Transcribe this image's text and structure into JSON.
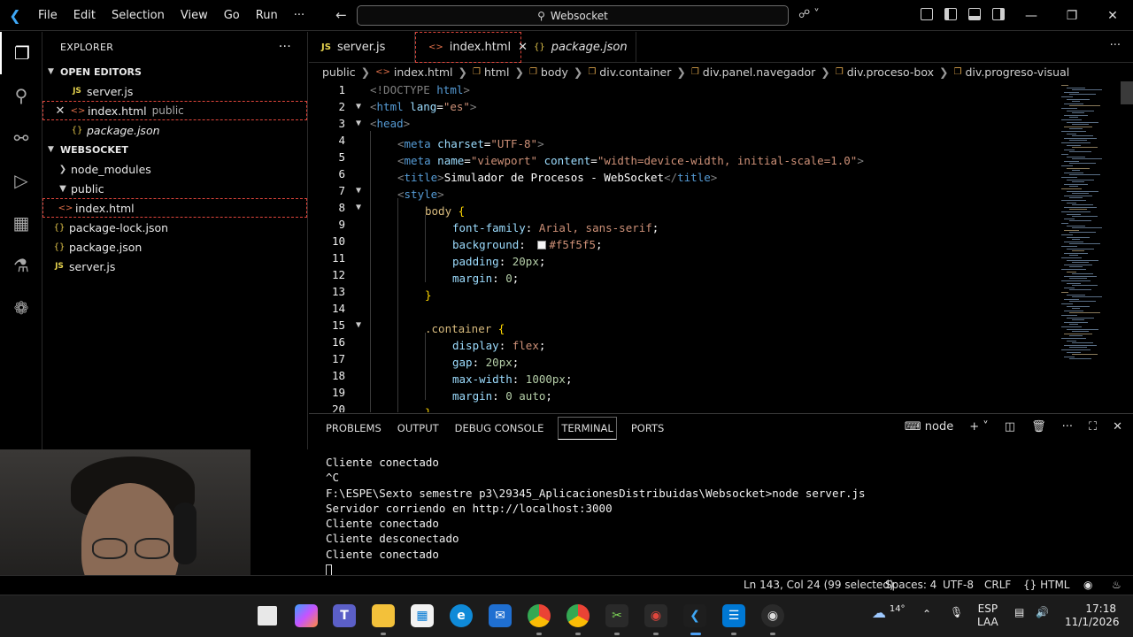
{
  "titlebar": {
    "menu": [
      "File",
      "Edit",
      "Selection",
      "View",
      "Go",
      "Run",
      "···"
    ],
    "search": "Websocket"
  },
  "sidebar": {
    "title": "EXPLORER",
    "open_editors_label": "OPEN EDITORS",
    "open_editors": [
      {
        "name": "server.js",
        "type": "js",
        "hint": ""
      },
      {
        "name": "index.html",
        "type": "html",
        "hint": "public"
      },
      {
        "name": "package.json",
        "type": "json",
        "hint": ""
      }
    ],
    "workspace_label": "WEBSOCKET",
    "tree": [
      {
        "name": "node_modules",
        "kind": "folder-closed"
      },
      {
        "name": "public",
        "kind": "folder-open"
      },
      {
        "name": "index.html",
        "kind": "html"
      },
      {
        "name": "package-lock.json",
        "kind": "json"
      },
      {
        "name": "package.json",
        "kind": "json"
      },
      {
        "name": "server.js",
        "kind": "js"
      }
    ]
  },
  "tabs": [
    {
      "label": "server.js",
      "icon": "JS"
    },
    {
      "label": "index.html",
      "icon": "<>"
    },
    {
      "label": "package.json",
      "icon": "{}"
    }
  ],
  "breadcrumb": [
    "public",
    "index.html",
    "html",
    "body",
    "div.container",
    "div.panel.navegador",
    "div.proceso-box",
    "div.progreso-visual"
  ],
  "code": {
    "line_numbers": [
      "1",
      "2",
      "3",
      "4",
      "5",
      "6",
      "7",
      "8",
      "9",
      "10",
      "11",
      "12",
      "13",
      "14",
      "15",
      "16",
      "17",
      "18",
      "19",
      "20"
    ],
    "l1": {
      "a": "<!DOCTYPE ",
      "b": "html",
      "c": ">"
    },
    "l2": {
      "a": "<",
      "b": "html",
      "c": "lang",
      "d": "=",
      "e": "\"es\"",
      "f": ">"
    },
    "l3": {
      "a": "<",
      "b": "head",
      "c": ">"
    },
    "l4": {
      "a": "<",
      "b": "meta",
      "c": "charset",
      "d": "=",
      "e": "\"UTF-8\"",
      "f": ">"
    },
    "l5": {
      "a": "<",
      "b": "meta",
      "c": "name",
      "d": "=",
      "e": "\"viewport\"",
      "f": "content",
      "g": "=",
      "h": "\"width=device-width, initial-scale=1.0\"",
      "i": ">"
    },
    "l6": {
      "a": "<",
      "b": "title",
      "c": ">",
      "d": "Simulador de Procesos - WebSocket",
      "e": "</",
      "f": "title",
      "g": ">"
    },
    "l7": {
      "a": "<",
      "b": "style",
      "c": ">"
    },
    "l8": {
      "a": "body",
      "b": " {"
    },
    "l9": {
      "a": "font-family",
      "b": ": ",
      "c": "Arial, sans-serif",
      "d": ";"
    },
    "l10": {
      "a": "background",
      "b": ": ",
      "c": "#f5f5f5",
      "d": ";"
    },
    "l11": {
      "a": "padding",
      "b": ": ",
      "c": "20px",
      "d": ";"
    },
    "l12": {
      "a": "margin",
      "b": ": ",
      "c": "0",
      "d": ";"
    },
    "l13": {
      "a": "}"
    },
    "l15": {
      "a": ".container",
      "b": " {"
    },
    "l16": {
      "a": "display",
      "b": ": ",
      "c": "flex",
      "d": ";"
    },
    "l17": {
      "a": "gap",
      "b": ": ",
      "c": "20px",
      "d": ";"
    },
    "l18": {
      "a": "max-width",
      "b": ": ",
      "c": "1000px",
      "d": ";"
    },
    "l19": {
      "a": "margin",
      "b": ": ",
      "c": "0 auto",
      "d": ";"
    },
    "l20": {
      "a": "}"
    }
  },
  "panel": {
    "tabs": [
      "PROBLEMS",
      "OUTPUT",
      "DEBUG CONSOLE",
      "TERMINAL",
      "PORTS"
    ],
    "terminal_name": "node",
    "lines": [
      "Cliente conectado",
      "^C",
      "F:\\ESPE\\Sexto semestre p3\\29345_AplicacionesDistribuidas\\Websocket>node server.js",
      "Servidor corriendo en http://localhost:3000",
      "Cliente conectado",
      "Cliente desconectado",
      "Cliente conectado"
    ]
  },
  "status": {
    "position": "Ln 143, Col 24 (99 selected)",
    "spaces": "Spaces: 4",
    "encoding": "UTF-8",
    "eol": "CRLF",
    "language": "HTML"
  },
  "taskbar": {
    "temp": "14°",
    "lang1": "ESP",
    "lang2": "LAA",
    "time": "17:18",
    "date": "11/1/2026"
  }
}
